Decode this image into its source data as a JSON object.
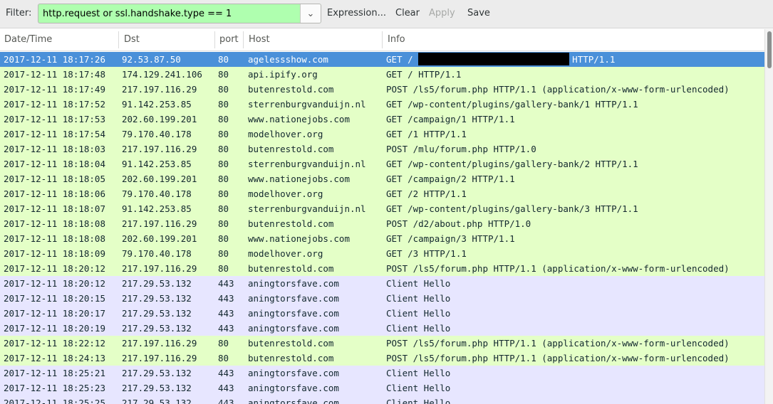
{
  "toolbar": {
    "filter_label": "Filter:",
    "filter_value": "http.request or ssl.handshake.type == 1",
    "dropdown_icon": "chevron-down-icon",
    "expression_label": "Expression...",
    "clear_label": "Clear",
    "apply_label": "Apply",
    "save_label": "Save"
  },
  "columns": {
    "time": "Date/Time",
    "dst": "Dst",
    "port": "port",
    "host": "Host",
    "info": "Info"
  },
  "colors": {
    "http_row": "#e4ffc7",
    "tls_row": "#e7e6ff",
    "selected_row": "#4a90d9",
    "filter_valid": "#afffaf"
  },
  "packets": [
    {
      "time": "2017-12-11 18:17:26",
      "dst": "92.53.87.50",
      "port": "80",
      "host": "agelessshow.com",
      "info_prefix": "GET /",
      "info_suffix": "HTTP/1.1",
      "redacted": true,
      "kind": "http",
      "selected": true
    },
    {
      "time": "2017-12-11 18:17:48",
      "dst": "174.129.241.106",
      "port": "80",
      "host": "api.ipify.org",
      "info": "GET / HTTP/1.1",
      "kind": "http"
    },
    {
      "time": "2017-12-11 18:17:49",
      "dst": "217.197.116.29",
      "port": "80",
      "host": "butenrestold.com",
      "info": "POST /ls5/forum.php HTTP/1.1  (application/x-www-form-urlencoded)",
      "kind": "http"
    },
    {
      "time": "2017-12-11 18:17:52",
      "dst": "91.142.253.85",
      "port": "80",
      "host": "sterrenburgvanduijn.nl",
      "info": "GET /wp-content/plugins/gallery-bank/1 HTTP/1.1",
      "kind": "http"
    },
    {
      "time": "2017-12-11 18:17:53",
      "dst": "202.60.199.201",
      "port": "80",
      "host": "www.nationejobs.com",
      "info": "GET /campaign/1 HTTP/1.1",
      "kind": "http"
    },
    {
      "time": "2017-12-11 18:17:54",
      "dst": "79.170.40.178",
      "port": "80",
      "host": "modelhover.org",
      "info": "GET /1 HTTP/1.1",
      "kind": "http"
    },
    {
      "time": "2017-12-11 18:18:03",
      "dst": "217.197.116.29",
      "port": "80",
      "host": "butenrestold.com",
      "info": "POST /mlu/forum.php HTTP/1.0",
      "kind": "http"
    },
    {
      "time": "2017-12-11 18:18:04",
      "dst": "91.142.253.85",
      "port": "80",
      "host": "sterrenburgvanduijn.nl",
      "info": "GET /wp-content/plugins/gallery-bank/2 HTTP/1.1",
      "kind": "http"
    },
    {
      "time": "2017-12-11 18:18:05",
      "dst": "202.60.199.201",
      "port": "80",
      "host": "www.nationejobs.com",
      "info": "GET /campaign/2 HTTP/1.1",
      "kind": "http"
    },
    {
      "time": "2017-12-11 18:18:06",
      "dst": "79.170.40.178",
      "port": "80",
      "host": "modelhover.org",
      "info": "GET /2 HTTP/1.1",
      "kind": "http"
    },
    {
      "time": "2017-12-11 18:18:07",
      "dst": "91.142.253.85",
      "port": "80",
      "host": "sterrenburgvanduijn.nl",
      "info": "GET /wp-content/plugins/gallery-bank/3 HTTP/1.1",
      "kind": "http"
    },
    {
      "time": "2017-12-11 18:18:08",
      "dst": "217.197.116.29",
      "port": "80",
      "host": "butenrestold.com",
      "info": "POST /d2/about.php HTTP/1.0",
      "kind": "http"
    },
    {
      "time": "2017-12-11 18:18:08",
      "dst": "202.60.199.201",
      "port": "80",
      "host": "www.nationejobs.com",
      "info": "GET /campaign/3 HTTP/1.1",
      "kind": "http"
    },
    {
      "time": "2017-12-11 18:18:09",
      "dst": "79.170.40.178",
      "port": "80",
      "host": "modelhover.org",
      "info": "GET /3 HTTP/1.1",
      "kind": "http"
    },
    {
      "time": "2017-12-11 18:20:12",
      "dst": "217.197.116.29",
      "port": "80",
      "host": "butenrestold.com",
      "info": "POST /ls5/forum.php HTTP/1.1  (application/x-www-form-urlencoded)",
      "kind": "http"
    },
    {
      "time": "2017-12-11 18:20:12",
      "dst": "217.29.53.132",
      "port": "443",
      "host": "aningtorsfave.com",
      "info": "Client Hello",
      "kind": "tls"
    },
    {
      "time": "2017-12-11 18:20:15",
      "dst": "217.29.53.132",
      "port": "443",
      "host": "aningtorsfave.com",
      "info": "Client Hello",
      "kind": "tls"
    },
    {
      "time": "2017-12-11 18:20:17",
      "dst": "217.29.53.132",
      "port": "443",
      "host": "aningtorsfave.com",
      "info": "Client Hello",
      "kind": "tls"
    },
    {
      "time": "2017-12-11 18:20:19",
      "dst": "217.29.53.132",
      "port": "443",
      "host": "aningtorsfave.com",
      "info": "Client Hello",
      "kind": "tls"
    },
    {
      "time": "2017-12-11 18:22:12",
      "dst": "217.197.116.29",
      "port": "80",
      "host": "butenrestold.com",
      "info": "POST /ls5/forum.php HTTP/1.1  (application/x-www-form-urlencoded)",
      "kind": "http"
    },
    {
      "time": "2017-12-11 18:24:13",
      "dst": "217.197.116.29",
      "port": "80",
      "host": "butenrestold.com",
      "info": "POST /ls5/forum.php HTTP/1.1  (application/x-www-form-urlencoded)",
      "kind": "http"
    },
    {
      "time": "2017-12-11 18:25:21",
      "dst": "217.29.53.132",
      "port": "443",
      "host": "aningtorsfave.com",
      "info": "Client Hello",
      "kind": "tls"
    },
    {
      "time": "2017-12-11 18:25:23",
      "dst": "217.29.53.132",
      "port": "443",
      "host": "aningtorsfave.com",
      "info": "Client Hello",
      "kind": "tls"
    },
    {
      "time": "2017-12-11 18:25:25",
      "dst": "217.29.53.132",
      "port": "443",
      "host": "aningtorsfave.com",
      "info": "Client Hello",
      "kind": "tls"
    }
  ]
}
